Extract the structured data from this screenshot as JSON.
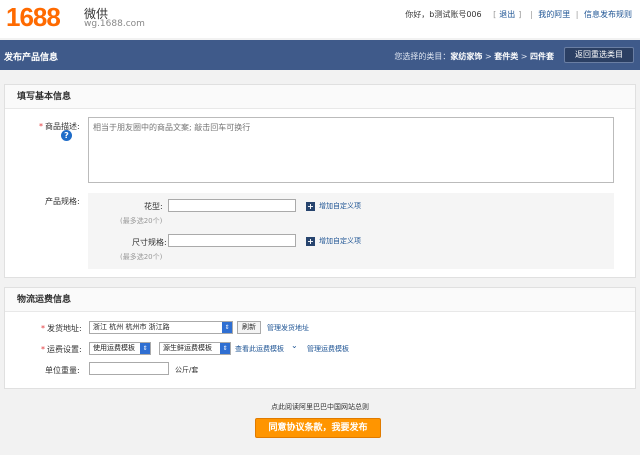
{
  "header": {
    "logo": "1688",
    "brand": "微供",
    "brand_url": "wg.1688.com",
    "greeting": "你好，b测试账号006",
    "logout": "退出",
    "my_alibaba": "我的阿里",
    "publish_rules": "信息发布规则"
  },
  "bar": {
    "title": "发布产品信息",
    "crumb_prefix": "您选择的类目：",
    "crumb_1": "家纺家饰",
    "crumb_2": "套件类",
    "crumb_3": "四件套",
    "crumb_sep": ">",
    "back_label": "返回重选类目"
  },
  "basic": {
    "title": "填写基本信息",
    "desc_label": "商品描述:",
    "desc_placeholder": "相当于朋友圈中的商品文案; 敲击回车可换行",
    "help": "?",
    "spec_label": "产品规格:",
    "pattern_label": "花型:",
    "pattern_hint": "(最多选20个)",
    "size_label": "尺寸规格:",
    "size_hint": "(最多选20个)",
    "add_custom": "增加自定义项",
    "plus": "+"
  },
  "logistics": {
    "title": "物流运费信息",
    "ship_from_label": "发货地址:",
    "ship_from_value": "浙江 杭州 杭州市 浙江路",
    "refresh": "刷新",
    "manage_address": "管理发货地址",
    "freight_label": "运费设置:",
    "template_type": "使用运费模板",
    "template_name": "源生鲜运费模板",
    "view_template": "查看此运费模板",
    "manage_template": "管理运费模板",
    "weight_label": "单位重量:",
    "weight_unit": "公斤/套"
  },
  "footer": {
    "agreement": "点此阅读阿里巴巴中国网站总则",
    "publish_button": "同意协议条款，我要发布"
  }
}
